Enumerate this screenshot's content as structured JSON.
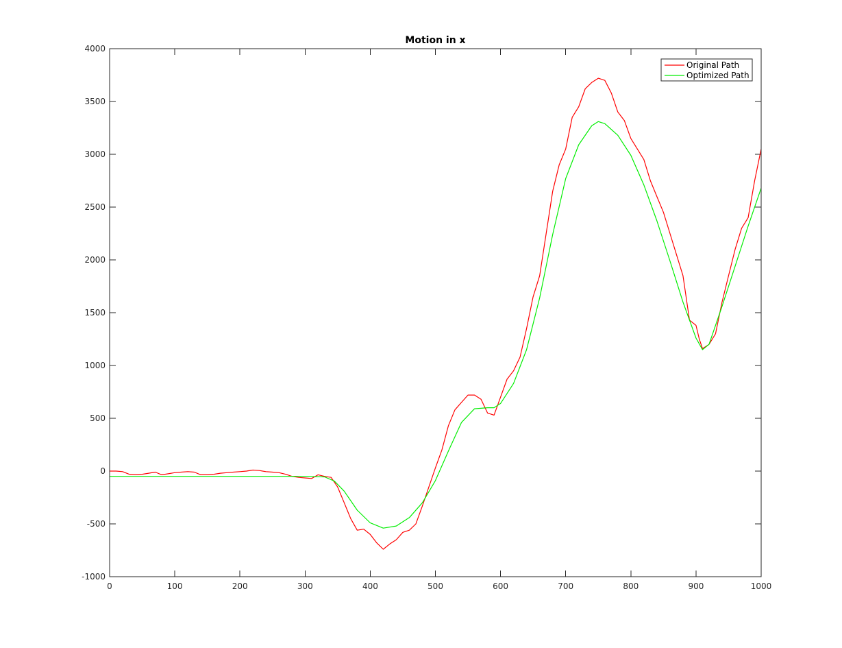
{
  "chart_data": {
    "type": "line",
    "title": "Motion in x",
    "xlabel": "",
    "ylabel": "",
    "xlim": [
      0,
      1000
    ],
    "ylim": [
      -1000,
      4000
    ],
    "xticks": [
      0,
      100,
      200,
      300,
      400,
      500,
      600,
      700,
      800,
      900,
      1000
    ],
    "yticks": [
      -1000,
      -500,
      0,
      500,
      1000,
      1500,
      2000,
      2500,
      3000,
      3500,
      4000
    ],
    "grid": false,
    "legend_position": "top-right",
    "series": [
      {
        "name": "Original Path",
        "color": "#ff0000",
        "x": [
          0,
          10,
          20,
          30,
          40,
          50,
          60,
          70,
          80,
          90,
          100,
          110,
          120,
          130,
          140,
          150,
          160,
          170,
          180,
          190,
          200,
          210,
          220,
          230,
          240,
          250,
          260,
          270,
          280,
          290,
          300,
          310,
          320,
          330,
          340,
          350,
          360,
          370,
          380,
          390,
          400,
          410,
          420,
          430,
          440,
          450,
          460,
          470,
          480,
          490,
          500,
          510,
          520,
          530,
          540,
          550,
          560,
          570,
          580,
          590,
          600,
          610,
          620,
          630,
          640,
          650,
          660,
          670,
          680,
          690,
          700,
          710,
          720,
          730,
          740,
          750,
          760,
          770,
          780,
          790,
          800,
          810,
          820,
          830,
          840,
          850,
          860,
          870,
          880,
          890,
          900,
          905,
          910,
          920,
          930,
          940,
          950,
          960,
          970,
          980,
          990,
          1000
        ],
        "y": [
          0,
          0,
          -5,
          -30,
          -35,
          -30,
          -20,
          -10,
          -35,
          -25,
          -15,
          -10,
          -5,
          -10,
          -35,
          -35,
          -30,
          -20,
          -15,
          -10,
          -5,
          0,
          10,
          5,
          -5,
          -10,
          -15,
          -30,
          -50,
          -60,
          -65,
          -70,
          -35,
          -50,
          -60,
          -150,
          -300,
          -450,
          -560,
          -550,
          -600,
          -680,
          -740,
          -690,
          -650,
          -580,
          -560,
          -500,
          -330,
          -150,
          30,
          200,
          430,
          580,
          650,
          720,
          720,
          680,
          550,
          530,
          700,
          870,
          950,
          1080,
          1350,
          1650,
          1850,
          2250,
          2650,
          2900,
          3050,
          3350,
          3450,
          3620,
          3680,
          3720,
          3700,
          3580,
          3400,
          3320,
          3150,
          3050,
          2950,
          2750,
          2600,
          2450,
          2250,
          2050,
          1850,
          1430,
          1380,
          1250,
          1160,
          1200,
          1300,
          1600,
          1850,
          2100,
          2300,
          2400,
          2750,
          3050
        ]
      },
      {
        "name": "Optimized Path",
        "color": "#00ee00",
        "x": [
          0,
          100,
          200,
          300,
          330,
          345,
          360,
          380,
          400,
          420,
          440,
          460,
          480,
          500,
          520,
          540,
          560,
          580,
          590,
          600,
          620,
          640,
          660,
          680,
          700,
          720,
          740,
          750,
          760,
          780,
          800,
          820,
          840,
          860,
          880,
          900,
          910,
          920,
          940,
          960,
          980,
          1000
        ],
        "y": [
          -50,
          -50,
          -50,
          -50,
          -55,
          -95,
          -190,
          -370,
          -490,
          -540,
          -520,
          -440,
          -300,
          -90,
          190,
          460,
          590,
          600,
          600,
          640,
          830,
          1150,
          1640,
          2240,
          2770,
          3090,
          3270,
          3310,
          3290,
          3180,
          2990,
          2710,
          2370,
          1990,
          1600,
          1260,
          1150,
          1200,
          1560,
          1940,
          2320,
          2680
        ]
      }
    ]
  }
}
